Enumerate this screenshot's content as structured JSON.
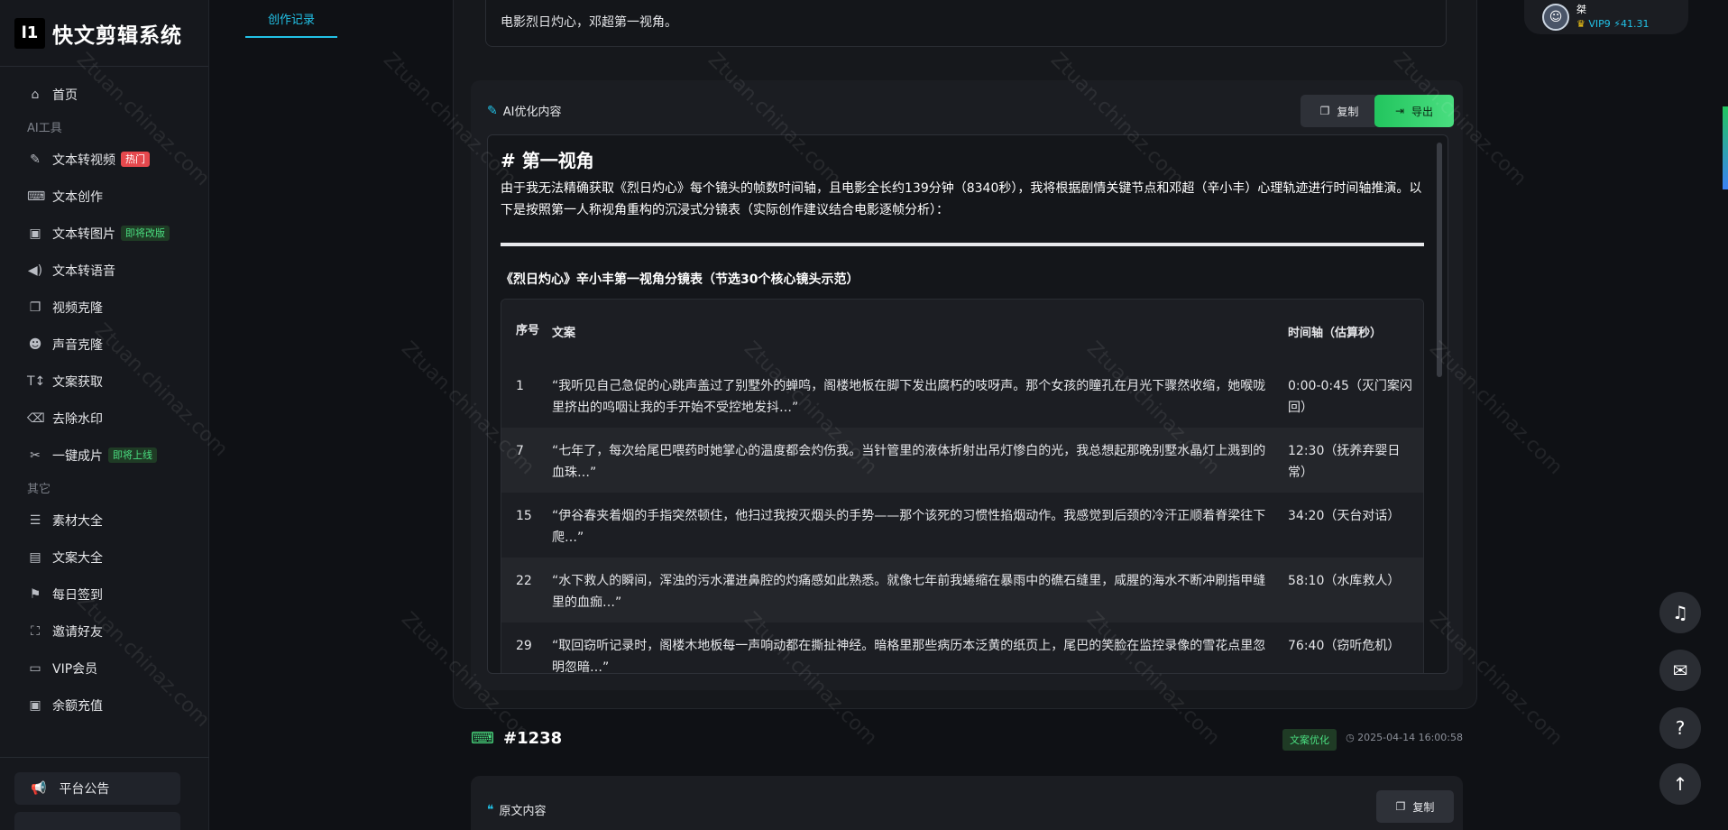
{
  "app": {
    "logo_mark": "l1",
    "title": "快文剪辑系统"
  },
  "sidebar": {
    "items": [
      {
        "label": "首页",
        "icon": "home-icon"
      },
      {
        "section": "AI工具"
      },
      {
        "label": "文本转视频",
        "icon": "video-icon",
        "badge": "热门"
      },
      {
        "label": "文本创作",
        "icon": "keyboard-icon"
      },
      {
        "label": "文本转图片",
        "icon": "image-icon",
        "badge": "即将改版"
      },
      {
        "label": "文本转语音",
        "icon": "speaker-icon"
      },
      {
        "label": "视频克隆",
        "icon": "clone-icon"
      },
      {
        "label": "声音克隆",
        "icon": "users-icon"
      },
      {
        "label": "文案获取",
        "icon": "text-icon"
      },
      {
        "label": "去除水印",
        "icon": "eraser-icon"
      },
      {
        "label": "一键成片",
        "icon": "scissors-icon",
        "badge": "即将上线"
      },
      {
        "section": "其它"
      },
      {
        "label": "素材大全",
        "icon": "list-icon"
      },
      {
        "label": "文案大全",
        "icon": "book-icon"
      },
      {
        "label": "每日签到",
        "icon": "flag-icon"
      },
      {
        "label": "邀请好友",
        "icon": "invite-icon"
      },
      {
        "label": "VIP会员",
        "icon": "card-icon"
      },
      {
        "label": "余额充值",
        "icon": "wallet-icon"
      }
    ],
    "notice": "平台公告"
  },
  "tab": {
    "label": "创作记录"
  },
  "top_card": {
    "text": "电影烈日灼心，邓超第一视角。"
  },
  "panel": {
    "title": "AI优化内容",
    "copy_label": "复制",
    "export_label": "导出",
    "heading": "# 第一视角",
    "intro": "由于我无法精确获取《烈日灼心》每个镜头的帧数时间轴，且电影全长约139分钟（8340秒），我将根据剧情关键节点和邓超（辛小丰）心理轨迹进行时间轴推演。以下是按照第一人称视角重构的沉浸式分镜表（实际创作建议结合电影逐帧分析）：",
    "subtitle": "《烈日灼心》辛小丰第一视角分镜表（节选30个核心镜头示范）",
    "table": {
      "headers": [
        "序号",
        "文案",
        "时间轴（估算秒）"
      ],
      "rows": [
        {
          "no": "1",
          "text": "“我听见自己急促的心跳声盖过了别墅外的蝉鸣，阁楼地板在脚下发出腐朽的吱呀声。那个女孩的瞳孔在月光下骤然收缩，她喉咙里挤出的呜咽让我的手开始不受控地发抖…”",
          "time": "0:00-0:45（灭门案闪回）"
        },
        {
          "no": "7",
          "text": "“七年了，每次给尾巴喂药时她掌心的温度都会灼伤我。当针管里的液体折射出吊灯惨白的光，我总想起那晚别墅水晶灯上溅到的血珠…”",
          "time": "12:30（抚养弃婴日常）"
        },
        {
          "no": "15",
          "text": "“伊谷春夹着烟的手指突然顿住，他扫过我按灭烟头的手势——那个该死的习惯性掐烟动作。我感觉到后颈的冷汗正顺着脊梁往下爬…”",
          "time": "34:20（天台对话）"
        },
        {
          "no": "22",
          "text": "“水下救人的瞬间，浑浊的污水灌进鼻腔的灼痛感如此熟悉。就像七年前我蜷缩在暴雨中的礁石缝里，咸腥的海水不断冲刷指甲缝里的血痂…”",
          "time": "58:10（水库救人）"
        },
        {
          "no": "29",
          "text": "“取回窃听记录时，阁楼木地板每一声响动都在撕扯神经。暗格里那些病历本泛黄的纸页上，尾巴的笑脸在监控录像的雪花点里忽明忽暗…”",
          "time": "76:40（窃听危机）"
        }
      ]
    }
  },
  "record": {
    "title": "#1238",
    "tag": "文案优化",
    "time": "2025-04-14 16:00:58",
    "panel_title": "原文内容",
    "copy_label": "复制"
  },
  "user": {
    "name": "桀",
    "vip": "VIP9",
    "balance": "41.31"
  },
  "watermark": "Ztuan.chinaz.com",
  "colors": {
    "accent": "#22c1e6",
    "green": "#22c55e",
    "hot": "#e5484d"
  }
}
